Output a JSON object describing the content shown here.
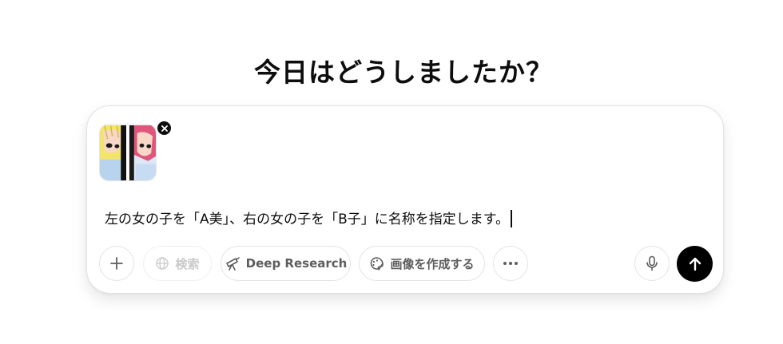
{
  "heading": "今日はどうしましたか？",
  "composer": {
    "attachment": {
      "remove_icon": "close-icon",
      "left_panel_color": "#f3e46a",
      "right_panel_color": "#e0557c"
    },
    "prompt_text": "左の女の子を「A美」、右の女の子を「B子」に名称を指定します。",
    "tools": {
      "add_icon": "plus-icon",
      "search": {
        "label": "検索",
        "icon": "globe-icon",
        "enabled": false
      },
      "deep_research": {
        "label": "Deep Research",
        "icon": "telescope-icon"
      },
      "create_image": {
        "label": "画像を作成する",
        "icon": "paint-palette-icon"
      },
      "more_icon": "more-horizontal-icon"
    },
    "mic_icon": "microphone-icon",
    "send_icon": "arrow-up-icon",
    "send_color": "#000000"
  }
}
